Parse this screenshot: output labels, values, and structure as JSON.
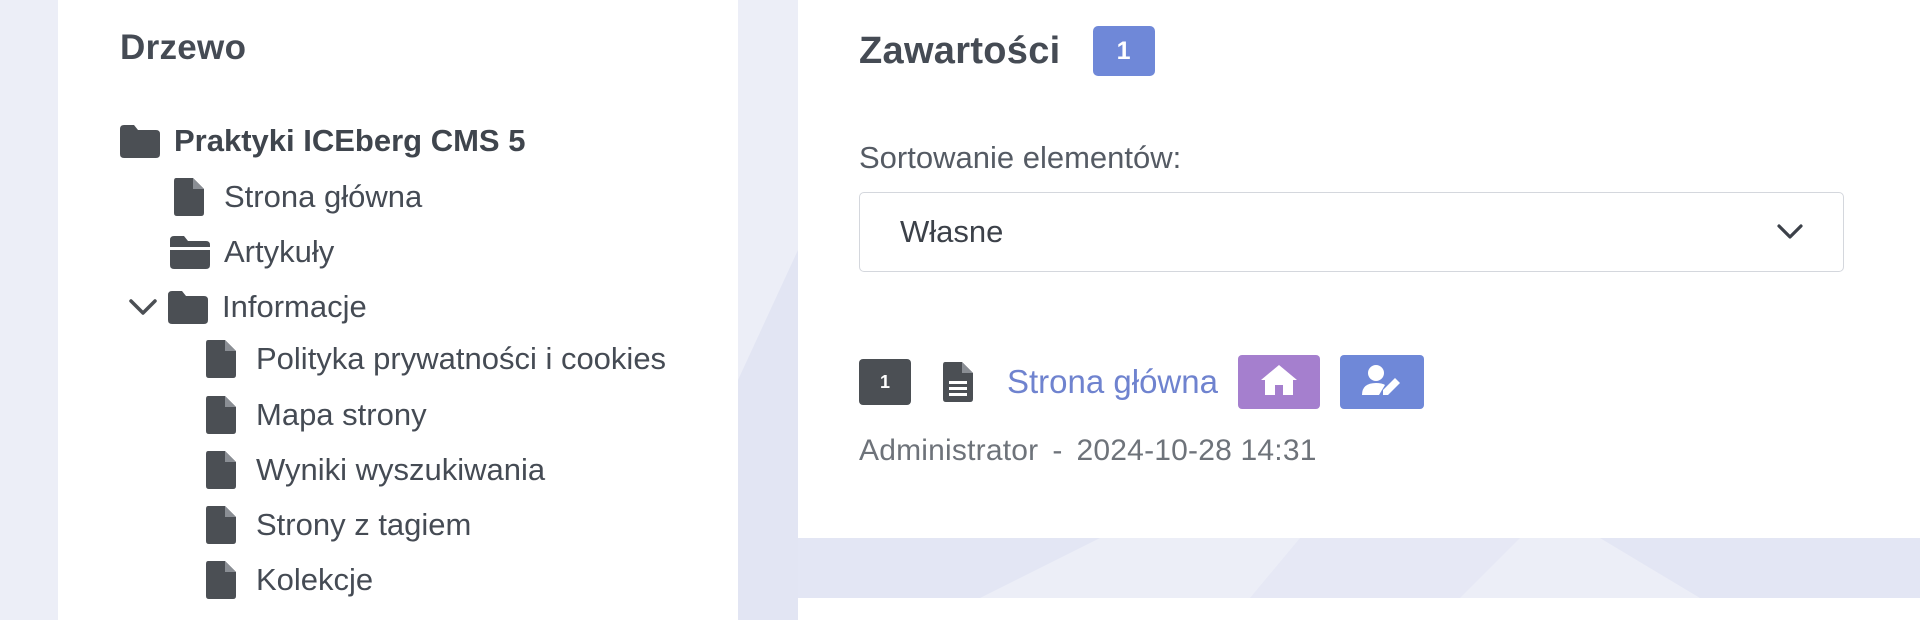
{
  "tree": {
    "title": "Drzewo",
    "items": [
      {
        "label": "Praktyki ICEberg CMS 5",
        "icon": "folder-icon"
      },
      {
        "label": "Strona główna",
        "icon": "file-icon"
      },
      {
        "label": "Artykuły",
        "icon": "folder-open-icon"
      },
      {
        "label": "Informacje",
        "icon": "folder-icon",
        "expanded": true
      },
      {
        "label": "Polityka prywatności i cookies",
        "icon": "file-icon"
      },
      {
        "label": "Mapa strony",
        "icon": "file-icon"
      },
      {
        "label": "Wyniki wyszukiwania",
        "icon": "file-icon"
      },
      {
        "label": "Strony z tagiem",
        "icon": "file-icon"
      },
      {
        "label": "Kolekcje",
        "icon": "file-icon"
      }
    ]
  },
  "contents": {
    "title": "Zawartości",
    "count": "1",
    "sort": {
      "label": "Sortowanie elementów:",
      "selected": "Własne"
    },
    "items": [
      {
        "position": "1",
        "title": "Strona główna",
        "author": "Administrator",
        "separator": "-",
        "date": "2024-10-28 14:31"
      }
    ]
  },
  "colors": {
    "accent_blue": "#6f88d8",
    "accent_purple": "#a57fce",
    "link": "#6f83cf",
    "dark_badge": "#4b4f54",
    "background": "#eceef7"
  }
}
